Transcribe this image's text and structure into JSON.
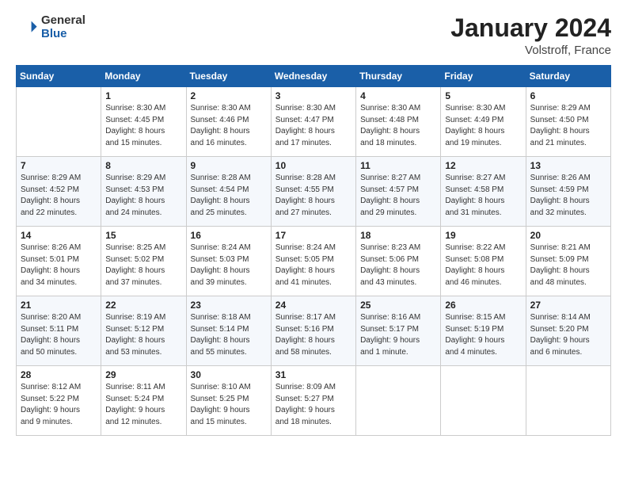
{
  "logo": {
    "general": "General",
    "blue": "Blue"
  },
  "title": "January 2024",
  "subtitle": "Volstroff, France",
  "days_header": [
    "Sunday",
    "Monday",
    "Tuesday",
    "Wednesday",
    "Thursday",
    "Friday",
    "Saturday"
  ],
  "weeks": [
    [
      {
        "num": "",
        "info": ""
      },
      {
        "num": "1",
        "info": "Sunrise: 8:30 AM\nSunset: 4:45 PM\nDaylight: 8 hours\nand 15 minutes."
      },
      {
        "num": "2",
        "info": "Sunrise: 8:30 AM\nSunset: 4:46 PM\nDaylight: 8 hours\nand 16 minutes."
      },
      {
        "num": "3",
        "info": "Sunrise: 8:30 AM\nSunset: 4:47 PM\nDaylight: 8 hours\nand 17 minutes."
      },
      {
        "num": "4",
        "info": "Sunrise: 8:30 AM\nSunset: 4:48 PM\nDaylight: 8 hours\nand 18 minutes."
      },
      {
        "num": "5",
        "info": "Sunrise: 8:30 AM\nSunset: 4:49 PM\nDaylight: 8 hours\nand 19 minutes."
      },
      {
        "num": "6",
        "info": "Sunrise: 8:29 AM\nSunset: 4:50 PM\nDaylight: 8 hours\nand 21 minutes."
      }
    ],
    [
      {
        "num": "7",
        "info": "Sunrise: 8:29 AM\nSunset: 4:52 PM\nDaylight: 8 hours\nand 22 minutes."
      },
      {
        "num": "8",
        "info": "Sunrise: 8:29 AM\nSunset: 4:53 PM\nDaylight: 8 hours\nand 24 minutes."
      },
      {
        "num": "9",
        "info": "Sunrise: 8:28 AM\nSunset: 4:54 PM\nDaylight: 8 hours\nand 25 minutes."
      },
      {
        "num": "10",
        "info": "Sunrise: 8:28 AM\nSunset: 4:55 PM\nDaylight: 8 hours\nand 27 minutes."
      },
      {
        "num": "11",
        "info": "Sunrise: 8:27 AM\nSunset: 4:57 PM\nDaylight: 8 hours\nand 29 minutes."
      },
      {
        "num": "12",
        "info": "Sunrise: 8:27 AM\nSunset: 4:58 PM\nDaylight: 8 hours\nand 31 minutes."
      },
      {
        "num": "13",
        "info": "Sunrise: 8:26 AM\nSunset: 4:59 PM\nDaylight: 8 hours\nand 32 minutes."
      }
    ],
    [
      {
        "num": "14",
        "info": "Sunrise: 8:26 AM\nSunset: 5:01 PM\nDaylight: 8 hours\nand 34 minutes."
      },
      {
        "num": "15",
        "info": "Sunrise: 8:25 AM\nSunset: 5:02 PM\nDaylight: 8 hours\nand 37 minutes."
      },
      {
        "num": "16",
        "info": "Sunrise: 8:24 AM\nSunset: 5:03 PM\nDaylight: 8 hours\nand 39 minutes."
      },
      {
        "num": "17",
        "info": "Sunrise: 8:24 AM\nSunset: 5:05 PM\nDaylight: 8 hours\nand 41 minutes."
      },
      {
        "num": "18",
        "info": "Sunrise: 8:23 AM\nSunset: 5:06 PM\nDaylight: 8 hours\nand 43 minutes."
      },
      {
        "num": "19",
        "info": "Sunrise: 8:22 AM\nSunset: 5:08 PM\nDaylight: 8 hours\nand 46 minutes."
      },
      {
        "num": "20",
        "info": "Sunrise: 8:21 AM\nSunset: 5:09 PM\nDaylight: 8 hours\nand 48 minutes."
      }
    ],
    [
      {
        "num": "21",
        "info": "Sunrise: 8:20 AM\nSunset: 5:11 PM\nDaylight: 8 hours\nand 50 minutes."
      },
      {
        "num": "22",
        "info": "Sunrise: 8:19 AM\nSunset: 5:12 PM\nDaylight: 8 hours\nand 53 minutes."
      },
      {
        "num": "23",
        "info": "Sunrise: 8:18 AM\nSunset: 5:14 PM\nDaylight: 8 hours\nand 55 minutes."
      },
      {
        "num": "24",
        "info": "Sunrise: 8:17 AM\nSunset: 5:16 PM\nDaylight: 8 hours\nand 58 minutes."
      },
      {
        "num": "25",
        "info": "Sunrise: 8:16 AM\nSunset: 5:17 PM\nDaylight: 9 hours\nand 1 minute."
      },
      {
        "num": "26",
        "info": "Sunrise: 8:15 AM\nSunset: 5:19 PM\nDaylight: 9 hours\nand 4 minutes."
      },
      {
        "num": "27",
        "info": "Sunrise: 8:14 AM\nSunset: 5:20 PM\nDaylight: 9 hours\nand 6 minutes."
      }
    ],
    [
      {
        "num": "28",
        "info": "Sunrise: 8:12 AM\nSunset: 5:22 PM\nDaylight: 9 hours\nand 9 minutes."
      },
      {
        "num": "29",
        "info": "Sunrise: 8:11 AM\nSunset: 5:24 PM\nDaylight: 9 hours\nand 12 minutes."
      },
      {
        "num": "30",
        "info": "Sunrise: 8:10 AM\nSunset: 5:25 PM\nDaylight: 9 hours\nand 15 minutes."
      },
      {
        "num": "31",
        "info": "Sunrise: 8:09 AM\nSunset: 5:27 PM\nDaylight: 9 hours\nand 18 minutes."
      },
      {
        "num": "",
        "info": ""
      },
      {
        "num": "",
        "info": ""
      },
      {
        "num": "",
        "info": ""
      }
    ]
  ]
}
